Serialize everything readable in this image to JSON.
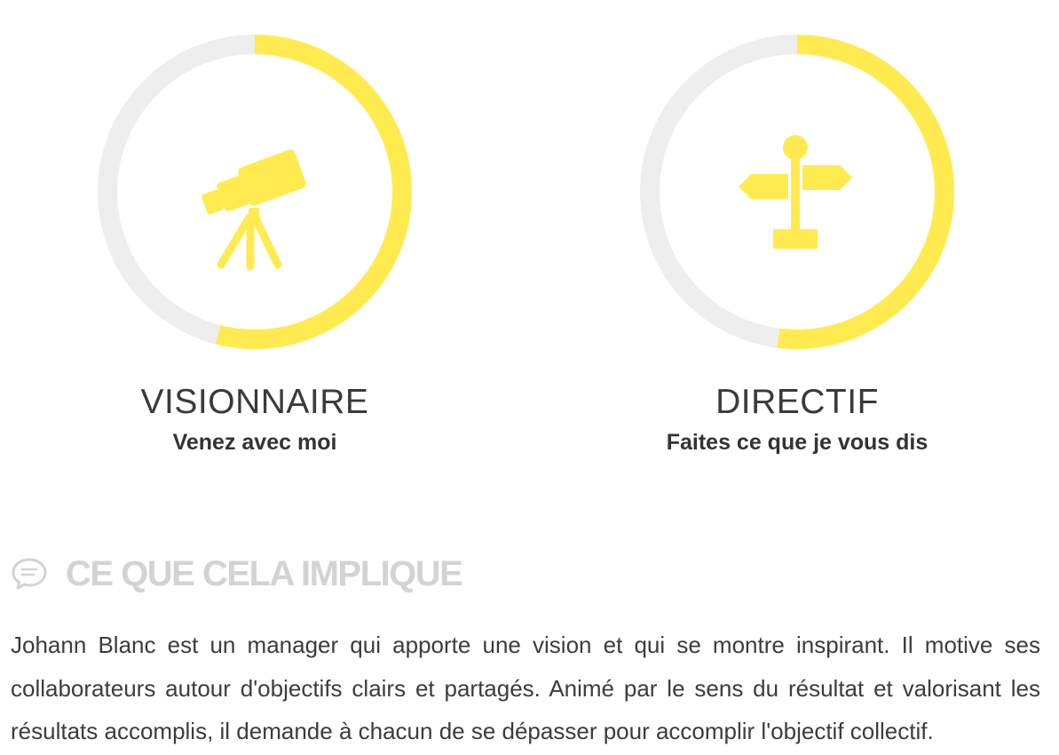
{
  "colors": {
    "accent": "#ffeb4f",
    "track": "#eeeeee",
    "heading_gray": "#d3d3d3",
    "text": "#333333"
  },
  "profiles": [
    {
      "name": "VISIONNAIRE",
      "motto": "Venez avec moi",
      "progress": 0.54,
      "icon": "telescope-icon"
    },
    {
      "name": "DIRECTIF",
      "motto": "Faites ce que je vous dis",
      "progress": 0.52,
      "icon": "signpost-icon"
    }
  ],
  "section": {
    "icon": "speech-bubble-icon",
    "title": "CE QUE CELA IMPLIQUE",
    "body": "Johann Blanc est un manager qui apporte une vision et qui se montre inspirant. Il motive ses collaborateurs autour d'objectifs clairs et partagés. Animé par le sens du résultat et valorisant les résultats accomplis, il demande à chacun de se dépasser pour accomplir l'objectif collectif."
  }
}
